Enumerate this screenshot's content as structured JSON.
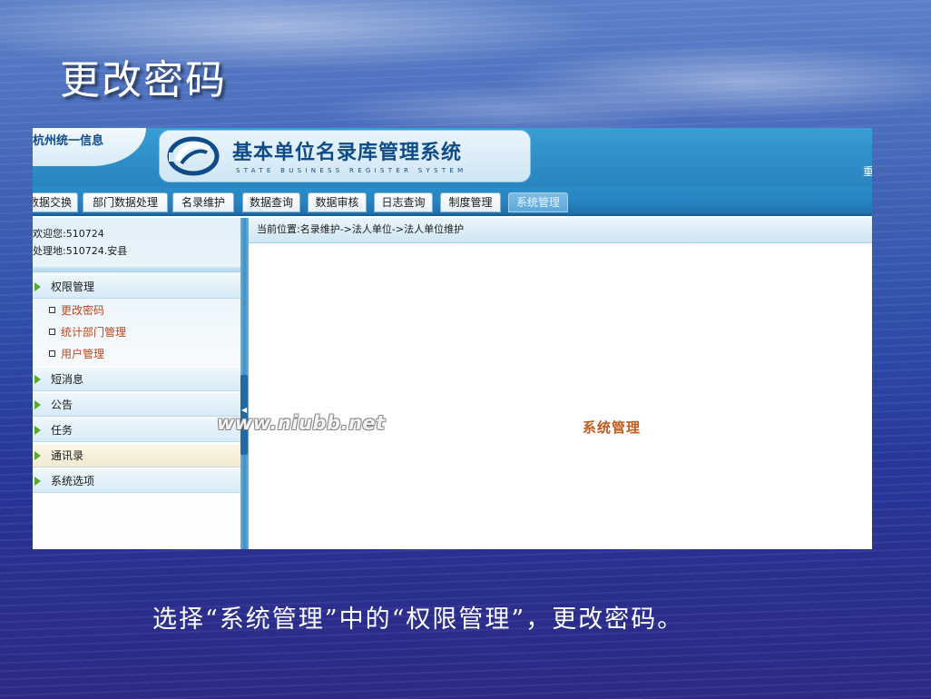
{
  "slide": {
    "title": "更改密码",
    "caption": "选择“系统管理”中的“权限管理”，更改密码。"
  },
  "header": {
    "org_name": "杭州统一信息",
    "system_name": "基本单位名录库管理系统",
    "system_name_en": "STATE BUSINESS REGISTER SYSTEM",
    "right_text": "重"
  },
  "nav": {
    "tabs": [
      {
        "label": "数据交换"
      },
      {
        "label": "部门数据处理"
      },
      {
        "label": "名录维护"
      },
      {
        "label": "数据查询"
      },
      {
        "label": "数据审核"
      },
      {
        "label": "日志查询"
      },
      {
        "label": "制度管理"
      },
      {
        "label": "系统管理",
        "active": true
      }
    ]
  },
  "sidebar": {
    "welcome_label": "欢迎您:",
    "welcome_value": "510724",
    "location_label": "处理地:",
    "location_value": "510724.安县",
    "menus": [
      {
        "label": "权限管理",
        "expanded": true,
        "items": [
          {
            "label": "更改密码"
          },
          {
            "label": "统计部门管理"
          },
          {
            "label": "用户管理"
          }
        ]
      },
      {
        "label": "短消息"
      },
      {
        "label": "公告"
      },
      {
        "label": "任务"
      },
      {
        "label": "通讯录"
      },
      {
        "label": "系统选项"
      }
    ]
  },
  "main": {
    "breadcrumb": "当前位置:名录维护->法人单位->法人单位维护",
    "center_title": "系统管理"
  },
  "watermark": "www.niubb.net",
  "colors": {
    "banner": "#2f8ec8",
    "nav_active": "#5ea8db",
    "submenu_text": "#c0471b",
    "center_title": "#c25a1c"
  }
}
